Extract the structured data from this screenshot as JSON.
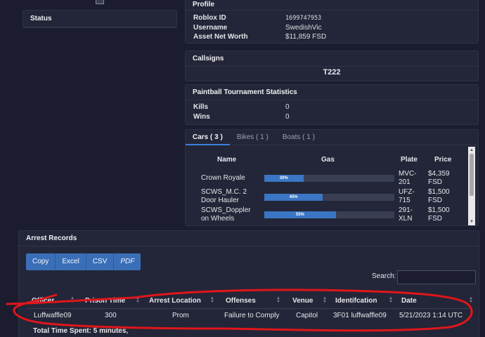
{
  "status": {
    "title": "Status"
  },
  "profile": {
    "title": "Profile",
    "rows": [
      {
        "label": "Roblox ID",
        "value": "1699747953"
      },
      {
        "label": "Username",
        "value": "SwedishVic"
      },
      {
        "label": "Asset Net Worth",
        "value": "$11,859 FSD"
      }
    ]
  },
  "callsigns": {
    "title": "Callsigns",
    "value": "T222"
  },
  "paintball": {
    "title": "Paintball Tournament Statistics",
    "rows": [
      {
        "label": "Kills",
        "value": "0"
      },
      {
        "label": "Wins",
        "value": "0"
      }
    ]
  },
  "vehicles": {
    "tabs": [
      "Cars ( 3 )",
      "Bikes ( 1 )",
      "Boats ( 1 )"
    ],
    "headers": {
      "name": "Name",
      "gas": "Gas",
      "plate": "Plate",
      "price": "Price"
    },
    "cars": [
      {
        "name_l1": "Crown Royale",
        "name_l2": "",
        "gas": 30,
        "gas_label": "30%",
        "plate_l1": "MVC-",
        "plate_l2": "201",
        "price_l1": "$4,359",
        "price_l2": "FSD"
      },
      {
        "name_l1": "SCWS_M.C. 2",
        "name_l2": "Door Hauler",
        "gas": 45,
        "gas_label": "45%",
        "plate_l1": "UFZ-",
        "plate_l2": "715",
        "price_l1": "$1,500",
        "price_l2": "FSD"
      },
      {
        "name_l1": "SCWS_Doppler",
        "name_l2": "on Wheels",
        "gas": 55,
        "gas_label": "55%",
        "plate_l1": "291-",
        "plate_l2": "XLN",
        "price_l1": "$1,500",
        "price_l2": "FSD"
      }
    ]
  },
  "arrests": {
    "title": "Arrest Records",
    "buttons": [
      "Copy",
      "Excel",
      "CSV",
      "PDF"
    ],
    "search_label": "Search:",
    "search_value": "",
    "columns": [
      "Officer",
      "Prison Time",
      "Arrest Location",
      "Offenses",
      "Venue",
      "Identifcation",
      "Date"
    ],
    "row": [
      "Luffwaffle09",
      "300",
      "Prom",
      "Failure to Comply",
      "Capitol",
      "3F01 luffwaffle09",
      "5/21/2023 1:14 UTC"
    ],
    "total_time": "Total Time Spent: 5 minutes,"
  },
  "colors": {
    "accent": "#3a76c4",
    "annotation": "#e0161b",
    "background": "#1b1d2e"
  }
}
